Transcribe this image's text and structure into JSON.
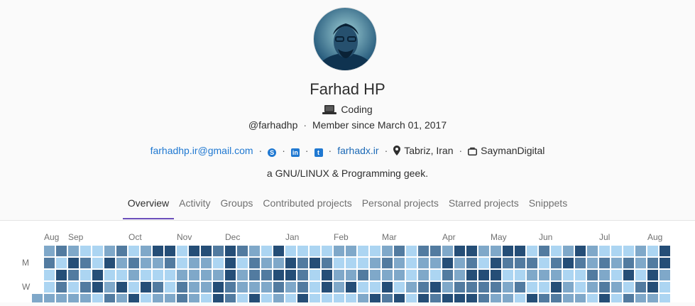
{
  "profile": {
    "name": "Farhad HP",
    "status_text": "Coding",
    "username": "@farhadhp",
    "member_since": "Member since March 01, 2017",
    "email": "farhadhp.ir@gmail.com",
    "website": "farhadx.ir",
    "location": "Tabriz, Iran",
    "organization": "SaymanDigital",
    "bio": "a GNU/LINUX & Programming geek."
  },
  "tabs": [
    {
      "label": "Overview",
      "active": true
    },
    {
      "label": "Activity",
      "active": false
    },
    {
      "label": "Groups",
      "active": false
    },
    {
      "label": "Contributed projects",
      "active": false
    },
    {
      "label": "Personal projects",
      "active": false
    },
    {
      "label": "Starred projects",
      "active": false
    },
    {
      "label": "Snippets",
      "active": false
    }
  ],
  "calendar": {
    "months": [
      "Aug",
      "Sep",
      "Oct",
      "Nov",
      "Dec",
      "Jan",
      "Feb",
      "Mar",
      "Apr",
      "May",
      "Jun",
      "Jul",
      "Aug"
    ],
    "day_labels": [
      "M",
      "W"
    ],
    "colors": [
      "#ededed",
      "#acd5f2",
      "#7fa8c9",
      "#527ba0",
      "#254e77"
    ]
  },
  "icons": {
    "laptop": "laptop-icon",
    "skype": "skype-icon",
    "linkedin": "linkedin-icon",
    "twitter": "twitter-icon",
    "location": "location-icon",
    "briefcase": "briefcase-icon"
  }
}
